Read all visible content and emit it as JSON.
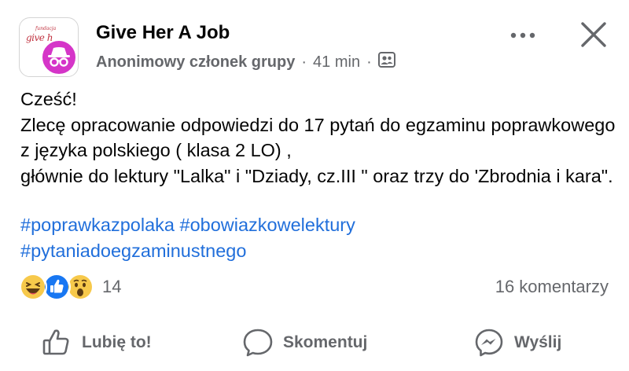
{
  "post": {
    "group_name": "Give Her A Job",
    "logo_text": "give h",
    "logo_sub": "fundacja",
    "author": "Anonimowy członek grupy",
    "separator": "·",
    "time": "41 min",
    "audience_icon": "group-members-icon",
    "text": "Cześć!\nZlecę opracowanie odpowiedzi do 17 pytań do egzaminu poprawkowego z języka polskiego ( klasa 2 LO) ,\ngłównie do lektury \"Lalka\" i \"Dziady, cz.III \" oraz trzy do 'Zbrodnia i kara\".",
    "hashtags": [
      "#poprawkazpolaka",
      "#obowiazkowelektury",
      "#pytaniadoegzaminustnego"
    ]
  },
  "reactions": {
    "types": [
      "haha",
      "like",
      "wow"
    ],
    "count": "14",
    "comments": "16 komentarzy"
  },
  "actions": {
    "like": "Lubię to!",
    "comment": "Skomentuj",
    "share": "Wyślij"
  },
  "colors": {
    "accent": "#216fdb",
    "secondary_text": "#65676b",
    "anon_badge": "#d535c8"
  }
}
